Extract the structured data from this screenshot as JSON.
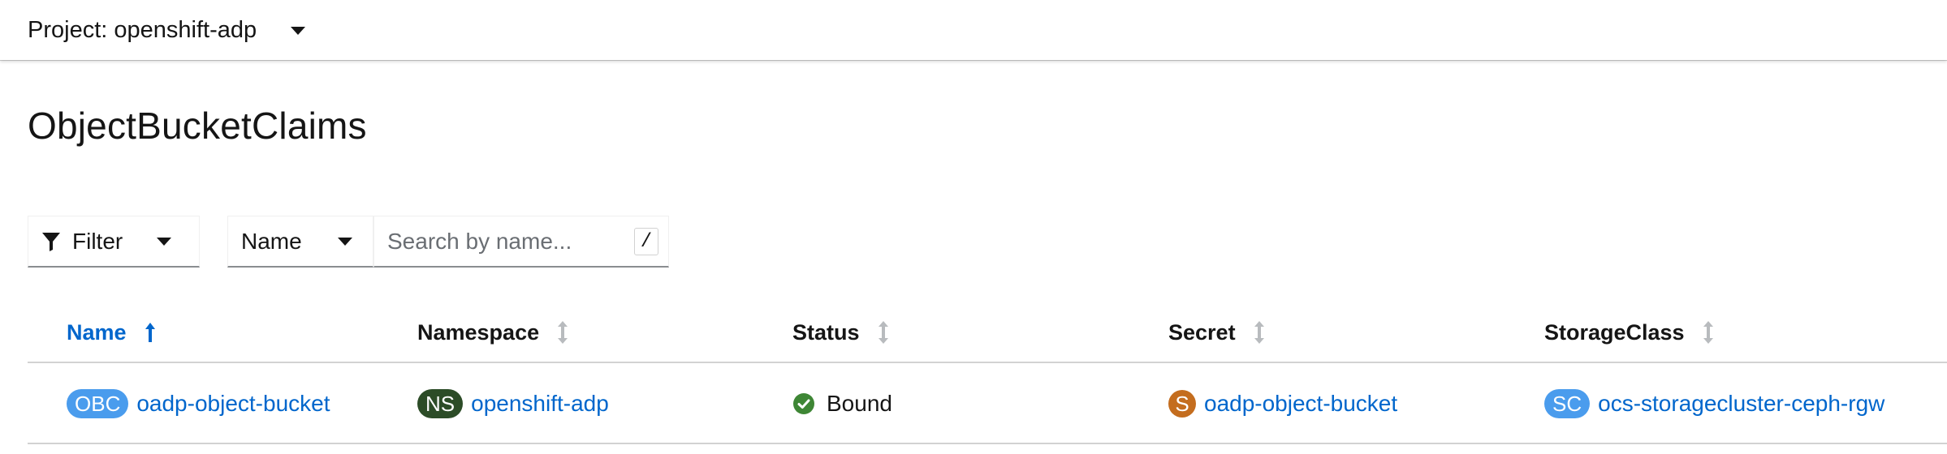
{
  "project": {
    "label": "Project: openshift-adp"
  },
  "page": {
    "title": "ObjectBucketClaims"
  },
  "toolbar": {
    "filter_label": "Filter",
    "search_type": "Name",
    "search_placeholder": "Search by name...",
    "search_value": "",
    "shortcut_hint": "/"
  },
  "table": {
    "columns": [
      {
        "label": "Name",
        "sorted": "ascending"
      },
      {
        "label": "Namespace"
      },
      {
        "label": "Status"
      },
      {
        "label": "Secret"
      },
      {
        "label": "StorageClass"
      }
    ],
    "rows": [
      {
        "name_badge": "OBC",
        "name": "oadp-object-bucket",
        "namespace_badge": "NS",
        "namespace": "openshift-adp",
        "status": "Bound",
        "secret_badge": "S",
        "secret": "oadp-object-bucket",
        "storageclass_badge": "SC",
        "storageclass": "ocs-storagecluster-ceph-rgw"
      }
    ]
  },
  "colors": {
    "link": "#0066cc",
    "obc_badge": "#4a9ced",
    "ns_badge": "#2c4c27",
    "secret_badge": "#c46d1e",
    "sc_badge": "#4a9ced",
    "status_ok": "#3e8635"
  },
  "icons": {
    "project_dropdown": "caret-down-icon",
    "filter": "filter-icon",
    "sort_active": "sort-ascending-icon",
    "sort_inactive": "sort-icon",
    "status": "check-circle-icon"
  }
}
